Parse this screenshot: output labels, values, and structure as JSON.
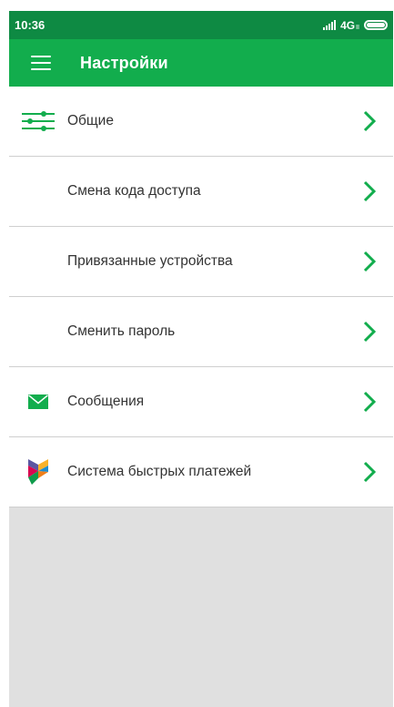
{
  "status_bar": {
    "time": "10:36",
    "network": "4G",
    "network_sub": "ll"
  },
  "app_bar": {
    "title": "Настройки",
    "menu_icon": "hamburger-menu-icon"
  },
  "colors": {
    "status_bar": "#0e8a43",
    "app_bar": "#12ad4d",
    "accent": "#12ad4d",
    "background": "#e0e0e0"
  },
  "items": [
    {
      "label": "Общие",
      "icon": "sliders-icon"
    },
    {
      "label": "Смена кода доступа",
      "icon": ""
    },
    {
      "label": "Привязанные устройства",
      "icon": ""
    },
    {
      "label": "Сменить пароль",
      "icon": ""
    },
    {
      "label": "Сообщения",
      "icon": "envelope-icon"
    },
    {
      "label": "Система быстрых платежей",
      "icon": "sbp-logo-icon"
    }
  ]
}
